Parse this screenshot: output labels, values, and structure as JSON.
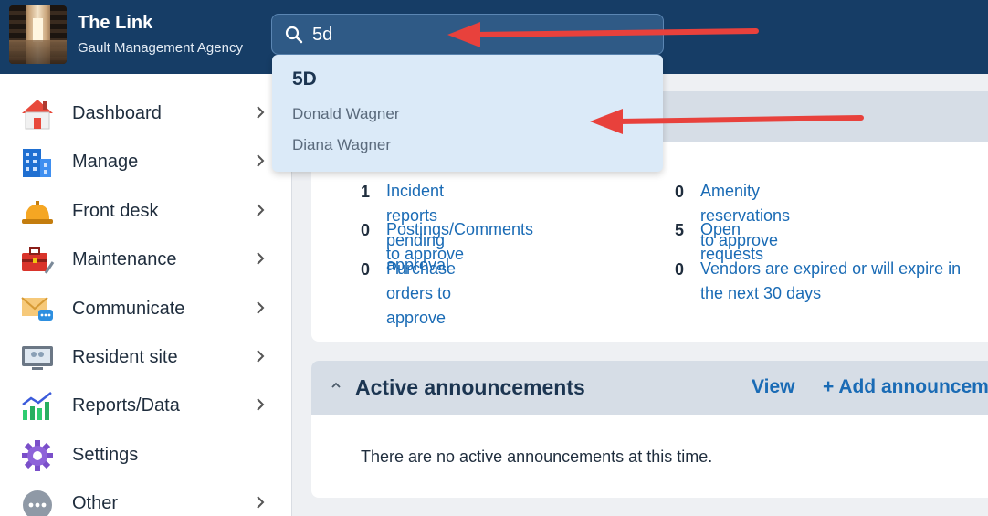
{
  "header": {
    "title": "The Link",
    "subtitle": "Gault Management Agency"
  },
  "search": {
    "value": "5d",
    "icon": "search-icon"
  },
  "search_results": {
    "primary": "5D",
    "items": [
      "Donald Wagner",
      "Diana Wagner"
    ]
  },
  "sidebar": {
    "items": [
      {
        "label": "Dashboard",
        "icon": "house-icon"
      },
      {
        "label": "Manage",
        "icon": "building-icon"
      },
      {
        "label": "Front desk",
        "icon": "bell-icon"
      },
      {
        "label": "Maintenance",
        "icon": "toolbox-icon"
      },
      {
        "label": "Communicate",
        "icon": "envelope-icon"
      },
      {
        "label": "Resident site",
        "icon": "monitor-icon"
      },
      {
        "label": "Reports/Data",
        "icon": "chart-icon"
      },
      {
        "label": "Settings",
        "icon": "gear-icon"
      },
      {
        "label": "Other",
        "icon": "more-icon"
      }
    ]
  },
  "summary": {
    "stats": [
      {
        "count": "1",
        "label": "Incident reports pending approval"
      },
      {
        "count": "0",
        "label": "Postings/Comments to approve"
      },
      {
        "count": "0",
        "label": "Purchase orders to approve"
      },
      {
        "count": "0",
        "label": "Amenity reservations to approve"
      },
      {
        "count": "5",
        "label": "Open requests"
      },
      {
        "count": "0",
        "label": "Vendors are expired or will expire in the next 30 days"
      }
    ]
  },
  "announcements": {
    "title": "Active announcements",
    "view_label": "View",
    "add_label": "+ Add announcement",
    "empty_text": "There are no active announcements at this time."
  },
  "colors": {
    "topbar": "#163d66",
    "link": "#1a6bb5",
    "annotation_arrow": "#e8413c"
  }
}
